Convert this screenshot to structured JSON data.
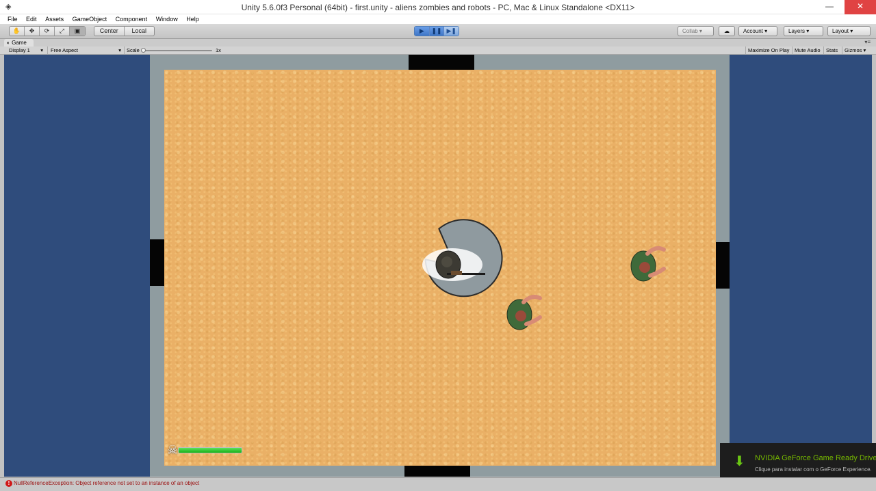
{
  "window": {
    "title": "Unity 5.6.0f3 Personal (64bit) - first.unity - aliens zombies and robots - PC, Mac & Linux Standalone <DX11>",
    "minimize": "—",
    "maximize": "☐",
    "close": "✕"
  },
  "menu": [
    "File",
    "Edit",
    "Assets",
    "GameObject",
    "Component",
    "Window",
    "Help"
  ],
  "toolbar": {
    "tools": [
      "hand-icon",
      "move-icon",
      "rotate-icon",
      "scale-icon",
      "rect-tool-icon"
    ],
    "pivot_center": "Center",
    "pivot_local": "Local",
    "collab": "Collab",
    "account": "Account",
    "layers": "Layers",
    "layout": "Layout"
  },
  "game_tab": {
    "title": "Game",
    "display": "Display 1",
    "aspect": "Free Aspect",
    "scale_label": "Scale",
    "scale_value": "1x",
    "maximize_on_play": "Maximize On Play",
    "mute_audio": "Mute Audio",
    "stats": "Stats",
    "gizmos": "Gizmos"
  },
  "hud": {
    "health_fraction": 1.0
  },
  "notification": {
    "title": "NVIDIA GeForce Game Ready Driver e",
    "subtitle": "Clique para instalar com o GeForce Experience."
  },
  "status": {
    "message": "NullReferenceException: Object reference not set to an instance of an object"
  },
  "colors": {
    "background_blue": "#2f4c7c",
    "sand": "#eab066",
    "wall": "#8f9ca0",
    "health": "#17b117"
  }
}
